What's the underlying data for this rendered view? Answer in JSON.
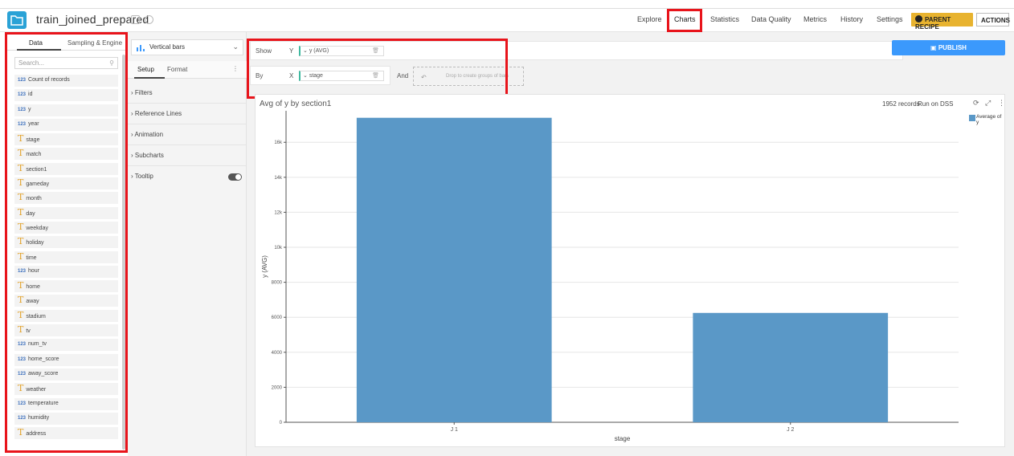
{
  "header": {
    "dataset_name": "train_joined_prepared",
    "nav": [
      "Explore",
      "Charts",
      "Statistics",
      "Data Quality",
      "Metrics",
      "History",
      "Settings"
    ],
    "parent_recipe": "PARENT RECIPE",
    "actions": "ACTIONS"
  },
  "left": {
    "tabs": [
      "Data",
      "Sampling & Engine"
    ],
    "search_placeholder": "Search...",
    "columns": [
      {
        "type": "123",
        "name": "Count of records"
      },
      {
        "type": "123",
        "name": "id"
      },
      {
        "type": "123",
        "name": "y"
      },
      {
        "type": "123",
        "name": "year"
      },
      {
        "type": "T",
        "name": "stage"
      },
      {
        "type": "T",
        "name": "match"
      },
      {
        "type": "T",
        "name": "section1"
      },
      {
        "type": "T",
        "name": "gameday"
      },
      {
        "type": "T",
        "name": "month"
      },
      {
        "type": "T",
        "name": "day"
      },
      {
        "type": "T",
        "name": "weekday"
      },
      {
        "type": "T",
        "name": "holiday"
      },
      {
        "type": "T",
        "name": "time"
      },
      {
        "type": "123",
        "name": "hour"
      },
      {
        "type": "T",
        "name": "home"
      },
      {
        "type": "T",
        "name": "away"
      },
      {
        "type": "T",
        "name": "stadium"
      },
      {
        "type": "T",
        "name": "tv"
      },
      {
        "type": "123",
        "name": "num_tv"
      },
      {
        "type": "123",
        "name": "home_score"
      },
      {
        "type": "123",
        "name": "away_score"
      },
      {
        "type": "T",
        "name": "weather"
      },
      {
        "type": "123",
        "name": "temperature"
      },
      {
        "type": "123",
        "name": "humidity"
      },
      {
        "type": "T",
        "name": "address"
      }
    ]
  },
  "middle": {
    "chart_type": "Vertical bars",
    "tab_setup": "Setup",
    "tab_format": "Format",
    "sections": [
      "Filters",
      "Reference Lines",
      "Animation",
      "Subcharts",
      "Tooltip"
    ]
  },
  "config": {
    "show_label": "Show",
    "show_axis": "Y",
    "show_value": "y (AVG)",
    "by_label": "By",
    "by_axis": "X",
    "by_value": "stage",
    "and_label": "And",
    "drop_hint": "Drop to create groups of bars",
    "publish": "PUBLISH"
  },
  "chart_header": {
    "title": "Avg of y by section1",
    "records": "1952 records",
    "run_on": "Run on DSS"
  },
  "chart_data": {
    "type": "bar",
    "title": "Avg of y by section1",
    "categories": [
      "J 1",
      "J 2"
    ],
    "series": [
      {
        "name": "Average of y",
        "values": [
          17400,
          6250
        ]
      }
    ],
    "xlabel": "stage",
    "ylabel": "y (AVG)",
    "ylim": [
      0,
      17800
    ],
    "yticks": [
      0,
      2000,
      4000,
      6000,
      8000,
      10000,
      12000,
      14000,
      16000
    ],
    "ytick_labels": [
      "0",
      "2000",
      "4000",
      "6000",
      "8000",
      "10k",
      "12k",
      "14k",
      "16k"
    ],
    "grid": true,
    "legend_position": "top-right",
    "bar_color": "#5a98c7"
  }
}
